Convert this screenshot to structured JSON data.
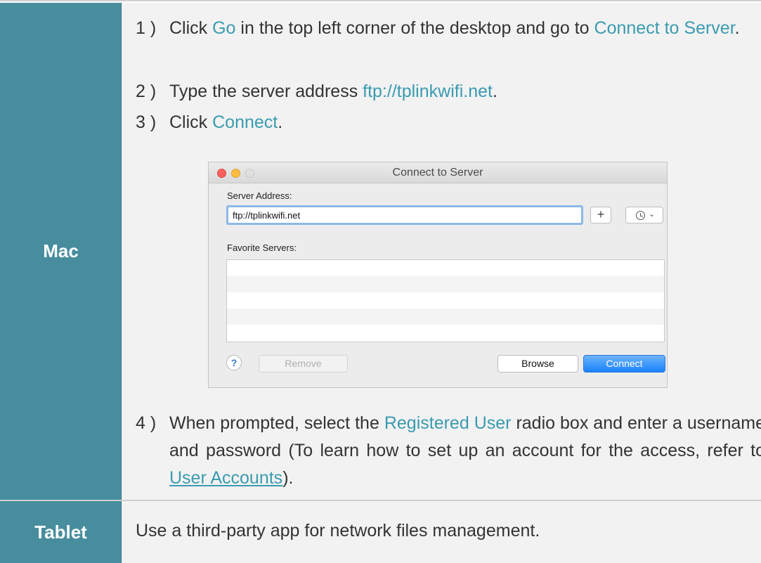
{
  "rows": {
    "mac": {
      "label": "Mac",
      "steps": [
        {
          "num": "1 )",
          "parts": [
            "Click ",
            "Go",
            " in the top left corner of the desktop and go to ",
            "Connect to Server",
            "."
          ]
        },
        {
          "num": "2 )",
          "parts": [
            "Type the server address ",
            "ftp://tplinkwifi.net",
            "."
          ]
        },
        {
          "num": "3 )",
          "parts": [
            "Click ",
            "Connect",
            "."
          ]
        },
        {
          "num": "4 )",
          "parts": [
            "When prompted, select the ",
            "Registered User",
            " radio box and enter a username and password (To learn how to set up an account for the access, refer to ",
            "User Accounts",
            ")."
          ]
        }
      ]
    },
    "tablet": {
      "label": "Tablet",
      "text": "Use a third-party app for network files management."
    }
  },
  "dialog": {
    "title": "Connect to Server",
    "server_address_label": "Server Address:",
    "server_address_value": "ftp://tplinkwifi.net",
    "favorites_label": "Favorite Servers:",
    "plus_label": "+",
    "chevron": "⌄",
    "help_label": "?",
    "remove_label": "Remove",
    "browse_label": "Browse",
    "connect_label": "Connect"
  },
  "colors": {
    "label_bg": "#478d9e",
    "content_bg": "#f2f2f2",
    "highlight": "#3a9bb0",
    "connect_blue": "#1a82fb"
  }
}
